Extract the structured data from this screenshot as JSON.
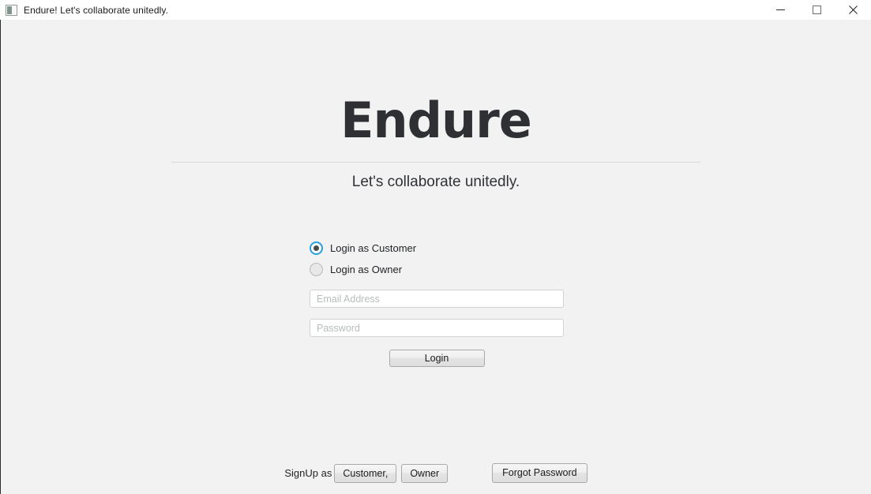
{
  "window": {
    "titlebar": {
      "icon": "app-window-icon",
      "title": "Endure! Let's collaborate unitedly.",
      "controls": {
        "minimize": "minimize-icon",
        "maximize": "maximize-icon",
        "close": "close-icon"
      }
    },
    "background_color": "#f2f2f2",
    "titlebar_color": "#ffffff"
  },
  "brand": {
    "title": "Endure",
    "subtitle": "Let's collaborate unitedly.",
    "title_color": "#2f3033",
    "rule_color": "#d8d8d8"
  },
  "form": {
    "role_options": [
      {
        "label": "Login as Customer",
        "selected": true
      },
      {
        "label": "Login as Owner",
        "selected": false
      }
    ],
    "selected_accent_color": "#2a9fe0",
    "email": {
      "value": "",
      "placeholder": "Email Address"
    },
    "password": {
      "value": "",
      "placeholder": "Password"
    },
    "login_button_label": "Login"
  },
  "footer": {
    "signup_label": "SignUp as",
    "signup_customer_label": "Customer,",
    "signup_owner_label": "Owner",
    "forgot_password_label": "Forgot Password"
  }
}
